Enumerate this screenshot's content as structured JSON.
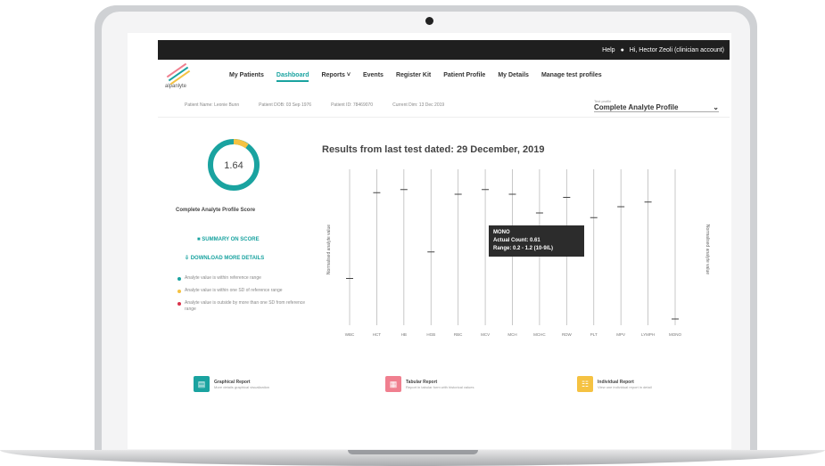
{
  "topbar": {
    "help": "Help",
    "user": "Hi, Hector Zeoli (clinician account)"
  },
  "logo": {
    "text": "alpanlyte"
  },
  "nav": {
    "items": [
      {
        "label": "My Patients"
      },
      {
        "label": "Dashboard"
      },
      {
        "label": "Reports"
      },
      {
        "label": "Events"
      },
      {
        "label": "Register Kit"
      },
      {
        "label": "Patient Profile"
      },
      {
        "label": "My Details"
      },
      {
        "label": "Manage test profiles"
      }
    ],
    "active_index": 1
  },
  "subbar": {
    "fields": [
      "Patient Name: Leonie Bunn",
      "Patient DOB: 03 Sep 1976",
      "Patient ID: 78469070",
      "Current Dim: 13 Dec 2019"
    ],
    "profile_label": "Test profile",
    "profile_value": "Complete Analyte Profile"
  },
  "score": {
    "value": "1.64",
    "label": "Complete Analyte Profile Score",
    "fraction": 0.92
  },
  "actions": {
    "summary": "SUMMARY ON SCORE",
    "download": "DOWNLOAD MORE DETAILS"
  },
  "legend": [
    {
      "text": "Analyte value is within reference range",
      "color": "#1aa3a0"
    },
    {
      "text": "Analyte value is within one SD of reference range",
      "color": "#f5c242"
    },
    {
      "text": "Analyte value is outside by more than one SD from reference range",
      "color": "#d9324b"
    }
  ],
  "chart_title": "Results from last test dated: 29 December, 2019",
  "tooltip": {
    "line1": "MONO",
    "line2": "Actual Count: 0.61",
    "line3": "Range: 0.2 - 1.2 (10-9/L)"
  },
  "cards": [
    {
      "title": "Graphical Report",
      "desc": "More details graphical visualization",
      "color": "#1aa3a0",
      "icon": "chart-icon"
    },
    {
      "title": "Tabular Report",
      "desc": "Report in tabular form with historical values",
      "color": "#f07f8f",
      "icon": "table-icon"
    },
    {
      "title": "Individual Report",
      "desc": "View one individual report in detail",
      "color": "#f5c242",
      "icon": "doc-icon"
    }
  ],
  "chart_data": {
    "type": "scatter",
    "ylabel": "Normalised analyte value",
    "categories": [
      "WBC",
      "HCT",
      "HB",
      "HGB",
      "RBC",
      "MCV",
      "MCH",
      "MCHC",
      "RDW",
      "PLT",
      "MPV",
      "LYMPH",
      "MONO"
    ],
    "values": [
      0.3,
      0.85,
      0.87,
      0.47,
      0.84,
      0.87,
      0.84,
      0.72,
      0.82,
      0.69,
      0.76,
      0.79,
      0.04
    ],
    "ylim": [
      0,
      1
    ]
  }
}
